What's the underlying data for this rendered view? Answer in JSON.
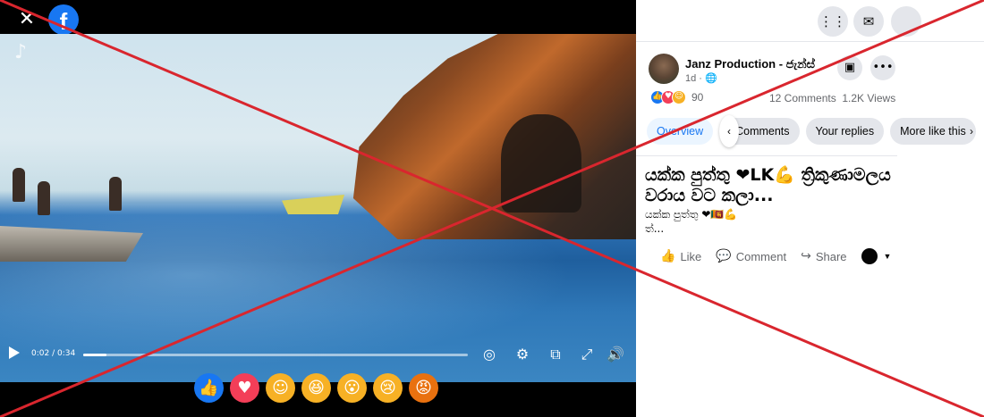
{
  "viewer": {
    "close_label": "✕",
    "logo_letter": "f",
    "watermark": "♪",
    "player": {
      "time": "0:02 / 0:34",
      "progress": 0.06
    },
    "reactions": [
      {
        "name": "like",
        "glyph": "👍",
        "color": "#1877f2"
      },
      {
        "name": "love",
        "glyph": "♥",
        "color": "#f33e58"
      },
      {
        "name": "care",
        "glyph": "☺",
        "color": "#f7b125"
      },
      {
        "name": "haha",
        "glyph": "😆",
        "color": "#f7b125"
      },
      {
        "name": "wow",
        "glyph": "😮",
        "color": "#f7b125"
      },
      {
        "name": "sad",
        "glyph": "😢",
        "color": "#f7b125"
      },
      {
        "name": "angry",
        "glyph": "😡",
        "color": "#e9710f"
      }
    ]
  },
  "post": {
    "author": "Janz Production - ජැන්ස්",
    "meta": "1d · 🌐",
    "reaction_count": "90",
    "comments": "12 Comments",
    "views": "1.2K Views",
    "tabs": [
      "Overview",
      "Comments",
      "Your replies",
      "More like this"
    ],
    "title": "යක්ක පුත්තු ❤LK💪 ත්‍රිකුණාමලය වරාය වට කලා...",
    "body_line1": "යක්ක පුත්තු ❤🇱🇰💪",
    "body_line2": "ත්...",
    "actions": {
      "like": "Like",
      "comment": "Comment",
      "share": "Share"
    }
  },
  "colors": {
    "accent": "#1877f2",
    "cross": "#d9262e"
  }
}
